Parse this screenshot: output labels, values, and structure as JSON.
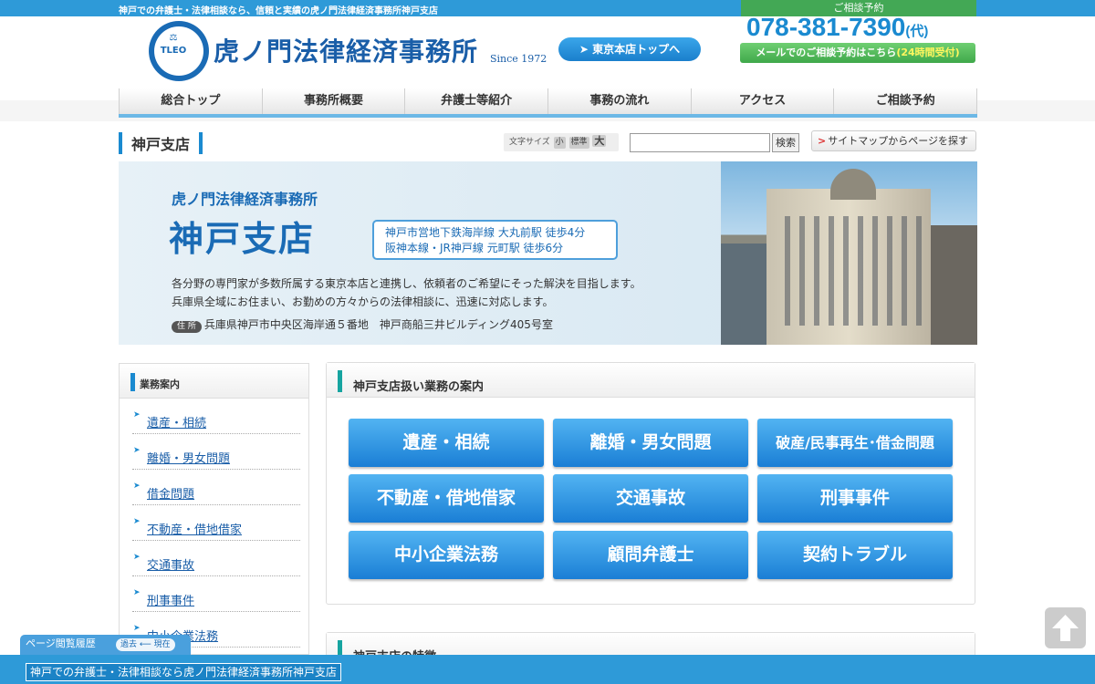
{
  "topbar": {
    "tagline": "神戸での弁護士・法律相談なら、信頼と実績の虎ノ門法律経済事務所神戸支店",
    "cta_label": "ご相談予約"
  },
  "header": {
    "logo_mark_text": "TLEO",
    "firm_name": "虎ノ門法律経済事務所",
    "since": "Since 1972",
    "tokyo_button": "➤ 東京本店トップへ",
    "phone": "078-381-7390",
    "phone_suffix": "(代)",
    "mail_button": "メールでのご相談予約はこちら",
    "mail_button_accent": "(24時間受付)"
  },
  "nav": {
    "items": [
      "総合トップ",
      "事務所概要",
      "弁護士等紹介",
      "事務の流れ",
      "アクセス",
      "ご相談予約"
    ]
  },
  "toolbar": {
    "branch_title": "神戸支店",
    "font_size_label": "文字サイズ",
    "font_small": "小",
    "font_medium": "標準",
    "font_large": "大",
    "search_placeholder": "",
    "search_button": "検索",
    "sitemap_button": "サイトマップからページを探す"
  },
  "hero": {
    "firm_name": "虎ノ門法律経済事務所",
    "branch": "神戸支店",
    "access_line1": "神戸市営地下鉄海岸線 大丸前駅 徒歩4分",
    "access_line2": "阪神本線・JR神戸線 元町駅 徒歩6分",
    "desc_line1": "各分野の専門家が多数所属する東京本店と連携し、依頼者のご希望にそった解決を目指します。",
    "desc_line2": "兵庫県全域にお住まい、お勤めの方々からの法律相談に、迅速に対応します。",
    "address_tag": "住 所",
    "address": "兵庫県神戸市中央区海岸通５番地　神戸商船三井ビルディング405号室"
  },
  "sidebar": {
    "title": "業務案内",
    "items": [
      "遺産・相続",
      "離婚・男女問題",
      "借金問題",
      "不動産・借地借家",
      "交通事故",
      "刑事事件",
      "中小企業法務"
    ]
  },
  "services": {
    "title": "神戸支店扱い業務の案内",
    "items": [
      "遺産・相続",
      "離婚・男女問題",
      "破産/民事再生･借金問題",
      "不動産・借地借家",
      "交通事故",
      "刑事事件",
      "中小企業法務",
      "顧問弁護士",
      "契約トラブル"
    ]
  },
  "features": {
    "title": "神戸支店の特徴"
  },
  "history": {
    "label": "ページ閲覧履歴",
    "nav": "過去 ⟵ 現在"
  },
  "footer": {
    "text": "神戸での弁護士・法律相談なら虎ノ門法律経済事務所神戸支店"
  }
}
